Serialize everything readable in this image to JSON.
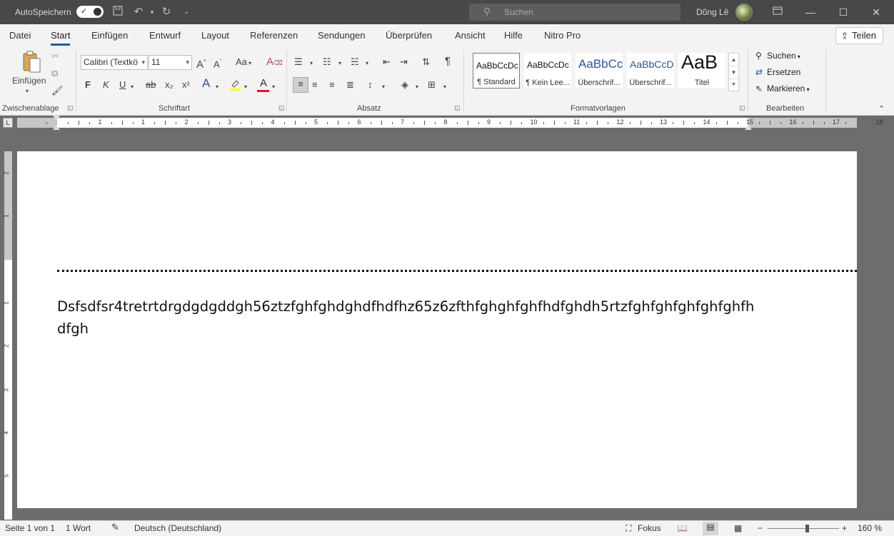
{
  "titlebar": {
    "autosave_label": "AutoSpeichern",
    "search_placeholder": "Suchen",
    "user_name": "Dũng Lê"
  },
  "tabs": [
    "Datei",
    "Start",
    "Einfügen",
    "Entwurf",
    "Layout",
    "Referenzen",
    "Sendungen",
    "Überprüfen",
    "Ansicht",
    "Hilfe",
    "Nitro Pro"
  ],
  "share_label": "Teilen",
  "ribbon": {
    "clipboard": {
      "paste_label": "Einfügen",
      "group_label": "Zwischenablage"
    },
    "font": {
      "family": "Calibri (Textkö",
      "size": "11",
      "group_label": "Schriftart",
      "bold": "F",
      "italic": "K",
      "underline": "U",
      "strike": "ab",
      "sub": "x₂",
      "sup": "x²",
      "case": "Aa"
    },
    "paragraph": {
      "group_label": "Absatz"
    },
    "styles": {
      "group_label": "Formatvorlagen",
      "items": [
        {
          "preview": "AaBbCcDc",
          "name": "¶ Standard"
        },
        {
          "preview": "AaBbCcDc",
          "name": "¶ Kein Lee..."
        },
        {
          "preview": "AaBbCc",
          "name": "Überschrif..."
        },
        {
          "preview": "AaBbCcD",
          "name": "Überschrif..."
        },
        {
          "preview": "AaB",
          "name": "Titel"
        }
      ]
    },
    "editing": {
      "group_label": "Bearbeiten",
      "find": "Suchen",
      "replace": "Ersetzen",
      "select": "Markieren"
    }
  },
  "ruler": {
    "labels": [
      "1",
      "2",
      "1",
      "1",
      "2",
      "3",
      "4",
      "5",
      "6",
      "7",
      "8",
      "9",
      "10",
      "11",
      "12",
      "13",
      "14",
      "15",
      "16",
      "17",
      "18"
    ]
  },
  "document": {
    "text": "Dsfsdfsr4tretrtdrgdgdgddgh56ztzfghfghdghdfhdfhz65z6zfthfghghfghfhdfghdh5rtzfghfghfghfghfghfhdfgh"
  },
  "statusbar": {
    "page": "Seite 1 von 1",
    "words": "1 Wort",
    "language": "Deutsch (Deutschland)",
    "focus": "Fokus",
    "zoom": "160 %"
  },
  "colors": {
    "accent": "#2b579a",
    "titlebar": "#484848",
    "highlight": "#ffff00",
    "font_color": "#e81123"
  }
}
